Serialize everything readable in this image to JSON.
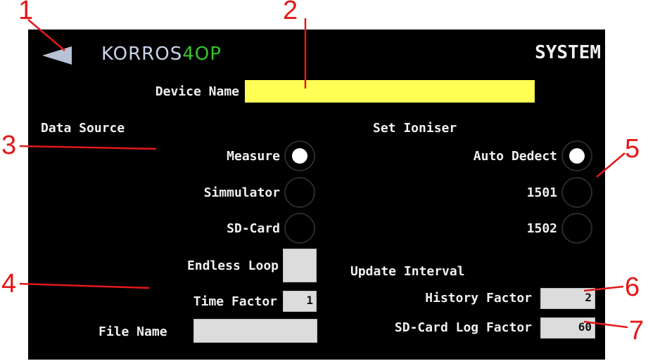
{
  "header": {
    "back_icon": "back-arrow-icon",
    "logo_prefix": "KORROS",
    "logo_suffix": "4OP",
    "title": "SYSTEM"
  },
  "device": {
    "label": "Device Name",
    "value": ""
  },
  "data_source": {
    "heading": "Data Source",
    "options": [
      {
        "label": "Measure",
        "selected": true
      },
      {
        "label": "Simmulator",
        "selected": false
      },
      {
        "label": "SD-Card",
        "selected": false
      }
    ],
    "endless_loop_label": "Endless Loop",
    "time_factor_label": "Time Factor",
    "time_factor_value": "1",
    "file_name_label": "File Name",
    "file_name_value": ""
  },
  "ioniser": {
    "heading": "Set Ioniser",
    "options": [
      {
        "label": "Auto Dedect",
        "selected": true
      },
      {
        "label": "1501",
        "selected": false
      },
      {
        "label": "1502",
        "selected": false
      }
    ]
  },
  "update": {
    "heading": "Update Interval",
    "history_label": "History Factor",
    "history_value": "2",
    "sdlog_label": "SD-Card Log Factor",
    "sdlog_value": "60"
  },
  "callouts": [
    "1",
    "2",
    "3",
    "4",
    "5",
    "6",
    "7"
  ],
  "colors": {
    "background": "#000000",
    "accent": "#ffff55",
    "logo_green": "#36c42a",
    "callout": "#e41818",
    "field": "#dcdcdc"
  }
}
